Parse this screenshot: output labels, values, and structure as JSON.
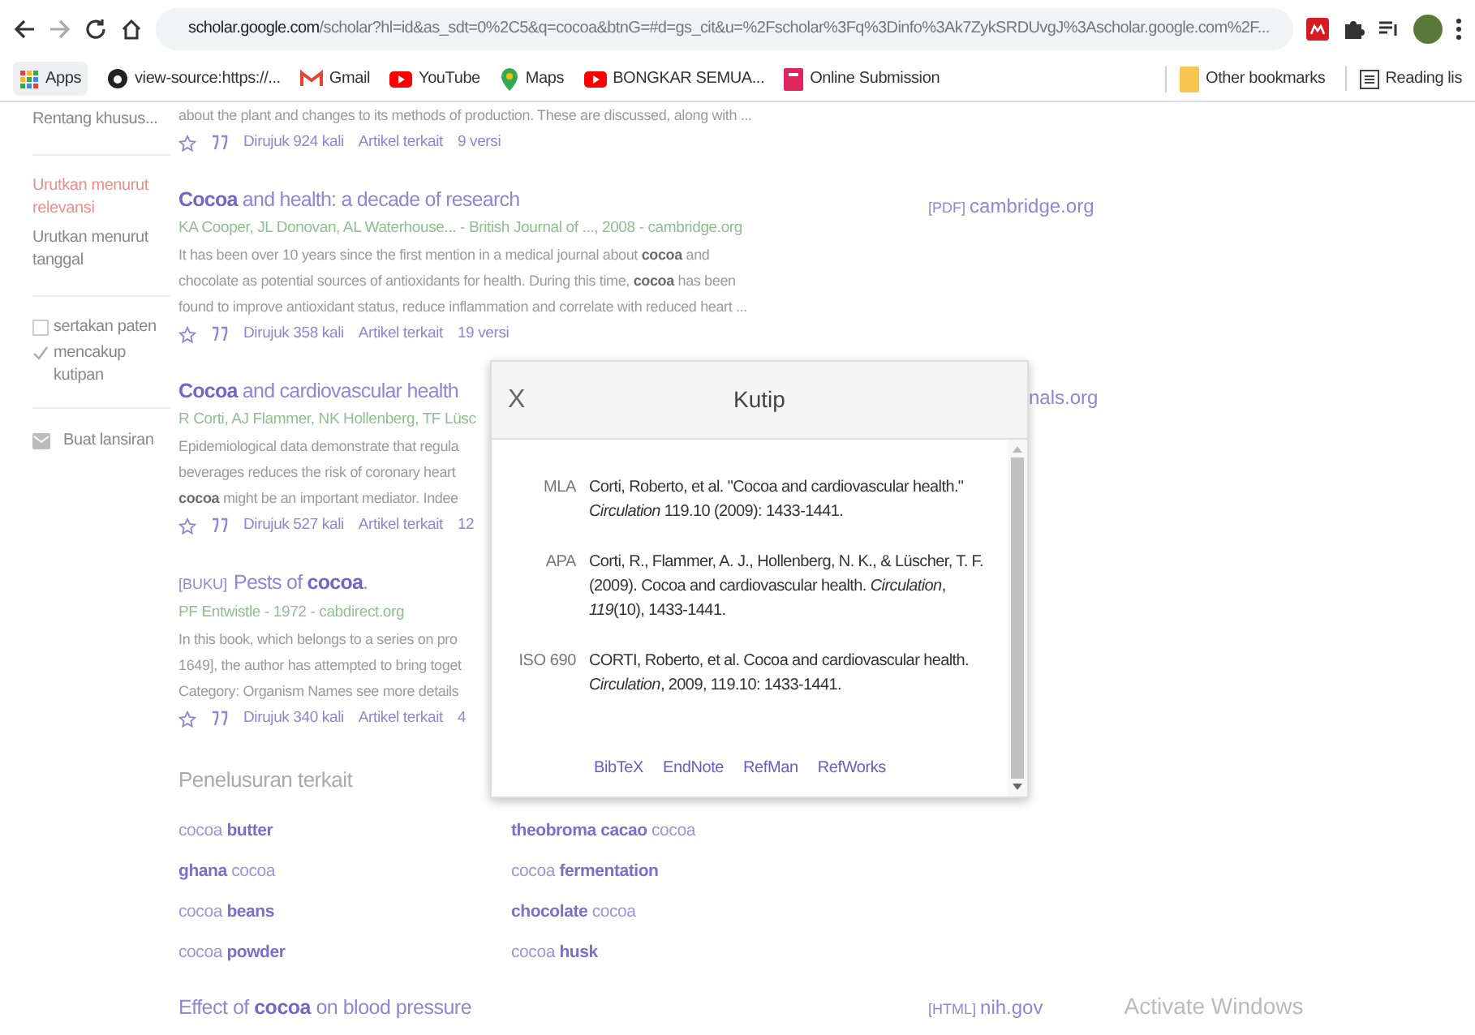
{
  "browser": {
    "url_host": "scholar.google.com",
    "url_path": "/scholar?hl=id&as_sdt=0%2C5&q=cocoa&btnG=#d=gs_cit&u=%2Fscholar%3Fq%3Dinfo%3Ak7ZykSRDUvgJ%3Ascholar.google.com%2F..."
  },
  "bookmarks": [
    "Apps",
    "view-source:https://...",
    "Gmail",
    "YouTube",
    "Maps",
    "BONGKAR SEMUA...",
    "Online Submission"
  ],
  "bookmarks_right": [
    "Other bookmarks",
    "Reading lis"
  ],
  "sidebar": {
    "range": "Rentang khusus...",
    "sort": [
      {
        "label": "Urutkan menurut relevansi",
        "selected": true
      },
      {
        "label": "Urutkan menurut tanggal",
        "selected": false
      }
    ],
    "filters": [
      {
        "label": "sertakan paten",
        "checked": false
      },
      {
        "label": "mencakup kutipan",
        "checked": true
      }
    ],
    "alert": "Buat lansiran"
  },
  "results": [
    {
      "snippet_lines": [
        "about the plant and changes to its methods of production. These are discussed, along with ..."
      ],
      "cited": "Dirujuk 924 kali",
      "related": "Artikel terkait",
      "versions": "9 versi"
    },
    {
      "title": "**Cocoa** and health: a decade of research",
      "authors": "KA Cooper, JL Donovan, AL Waterhouse... - British Journal of ..., 2008 - cambridge.org",
      "snippet_lines": [
        "It has been over 10 years since the first mention in a medical journal about **cocoa** and",
        "chocolate as potential sources of antioxidants for health. During this time, **cocoa** has been",
        "found to improve antioxidant status, reduce inflammation and correlate with reduced heart ..."
      ],
      "cited": "Dirujuk 358 kali",
      "related": "Artikel terkait",
      "versions": "19 versi",
      "side_link": {
        "tag": "[PDF]",
        "text": "cambridge.org"
      }
    },
    {
      "title": "**Cocoa** and cardiovascular health",
      "authors": "R Corti, AJ Flammer, NK Hollenberg, TF Lüsc",
      "snippet_lines": [
        "Epidemiological data demonstrate that regula",
        "beverages reduces the risk of coronary heart",
        "**cocoa** might be an important mediator. Indee"
      ],
      "cited": "Dirujuk 527 kali",
      "related": "Artikel terkait",
      "versions": "12",
      "side_link": {
        "text": "nals.org"
      }
    },
    {
      "tag": "[BUKU]",
      "title": "Pests of **cocoa**.",
      "authors": "PF Entwistle - 1972 - cabdirect.org",
      "snippet_lines": [
        "In this book, which belongs to a series on pro",
        "1649], the author has attempted to bring toget",
        "Category: Organism Names see more details"
      ],
      "cited": "Dirujuk 340 kali",
      "related": "Artikel terkait",
      "versions": "4"
    }
  ],
  "related_searches": {
    "heading": "Penelusuran terkait",
    "items": [
      "cocoa **butter**",
      "**theobroma cacao** cocoa",
      "**ghana** cocoa",
      "cocoa **fermentation**",
      "cocoa **beans**",
      "**chocolate** cocoa",
      "cocoa **powder**",
      "cocoa **husk**"
    ]
  },
  "next_result": {
    "title": "Effect of **cocoa** on blood pressure",
    "side_link": {
      "tag": "[HTML]",
      "text": "nih.gov"
    }
  },
  "citation_dialog": {
    "close": "X",
    "title": "Kutip",
    "styles": [
      {
        "label": "MLA",
        "text": "Corti, Roberto, et al. \"Cocoa and cardiovascular health.\" *Circulation* 119.10 (2009): 1433-1441."
      },
      {
        "label": "APA",
        "text": "Corti, R., Flammer, A. J., Hollenberg, N. K., & Lüscher, T. F. (2009). Cocoa and cardiovascular health. *Circulation*, *119*(10), 1433-1441."
      },
      {
        "label": "ISO 690",
        "text": "CORTI, Roberto, et al. Cocoa and cardiovascular health. *Circulation*, 2009, 119.10: 1433-1441."
      }
    ],
    "exports": [
      "BibTeX",
      "EndNote",
      "RefMan",
      "RefWorks"
    ]
  },
  "os_notice": "Activate Windows"
}
